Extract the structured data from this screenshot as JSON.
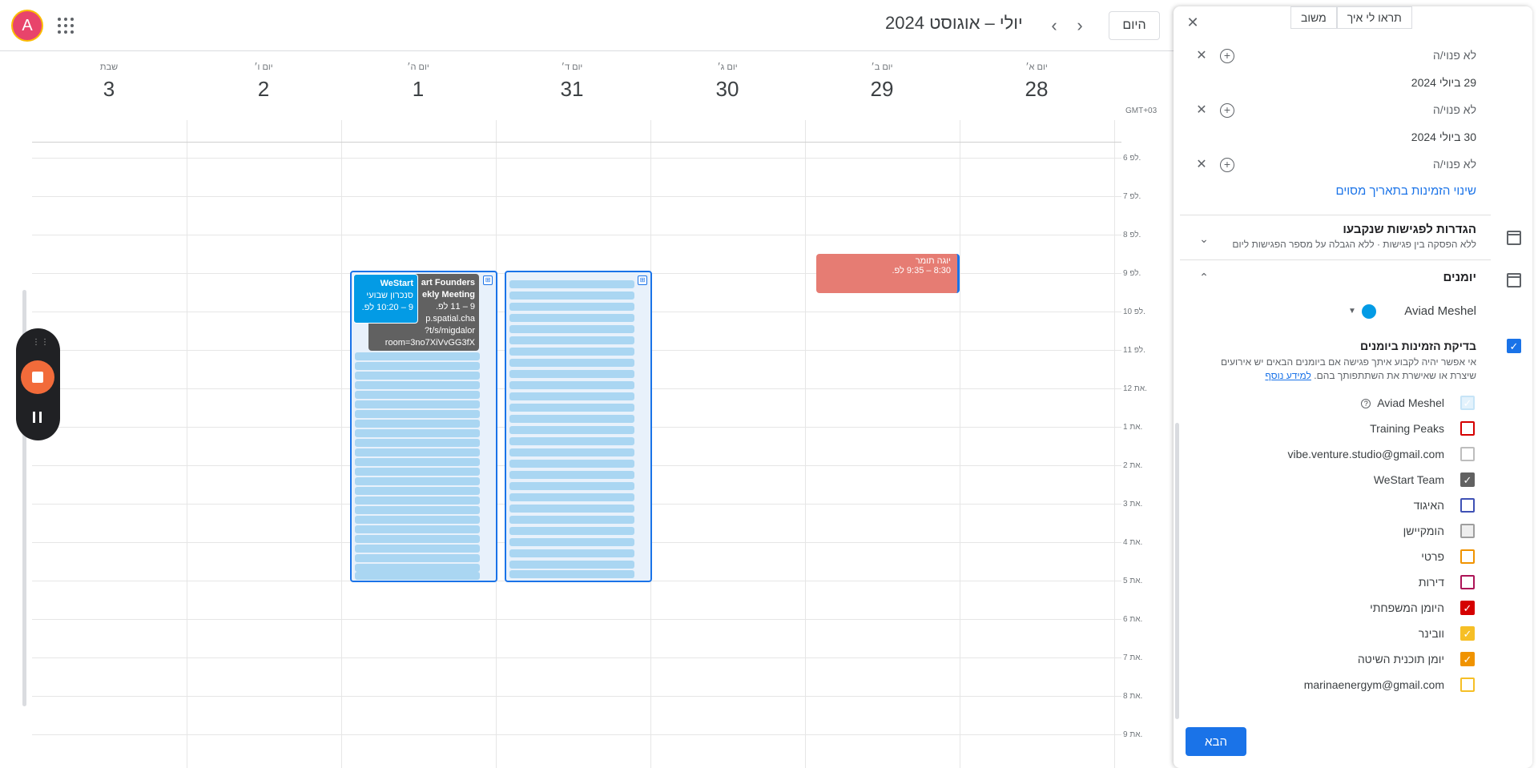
{
  "header": {
    "avatar_letter": "A",
    "today_label": "היום",
    "month_title": "יולי – אוגוסט 2024",
    "prev_glyph": "‹",
    "next_glyph": "›"
  },
  "timezone": "GMT+03",
  "days": [
    {
      "name": "יום א׳",
      "num": "28"
    },
    {
      "name": "יום ב׳",
      "num": "29"
    },
    {
      "name": "יום ג׳",
      "num": "30"
    },
    {
      "name": "יום ד׳",
      "num": "31"
    },
    {
      "name": "יום ה׳",
      "num": "1"
    },
    {
      "name": "יום ו׳",
      "num": "2"
    },
    {
      "name": "שבת",
      "num": "3"
    }
  ],
  "hours": [
    "6 לפ.",
    "7 לפ.",
    "8 לפ.",
    "9 לפ.",
    "10 לפ.",
    "11 לפ.",
    "12 את.",
    "1 את.",
    "2 את.",
    "3 את.",
    "4 את.",
    "5 את.",
    "6 את.",
    "7 את.",
    "8 את.",
    "9 את."
  ],
  "events": {
    "yoga": {
      "title": "יוגה תומר",
      "time": "8:30 – 9:35 לפ.",
      "color": "#e67c73"
    },
    "founders": {
      "title": "art Founders",
      "title2": "ekly Meeting",
      "time": "9 – 11 לפ.",
      "link1": "p.spatial.cha",
      "link2": "t/s/migdalor?",
      "link3": "room=3no7XiVvGG3fX",
      "color": "#616161"
    },
    "westart": {
      "title": "WeStart",
      "subtitle": "סנכרון שבועי",
      "time": "9 – 10:20 לפ.",
      "color": "#039be5"
    }
  },
  "recorder": {
    "dots": "⋮⋮"
  },
  "panel": {
    "close_glyph": "✕",
    "tabs": [
      "תראו לי איך",
      "משוב"
    ],
    "unavailable_label": "לא פנוי/ה",
    "dates": [
      "29 ביולי 2024",
      "30 ביולי 2024"
    ],
    "change_link": "שינוי הזמינות בתאריך מסוים",
    "booked_settings": {
      "title": "הגדרות לפגישות שנקבעו",
      "subtitle": "ללא הפסקה בין פגישות · ללא הגבלה על מספר הפגישות ליום"
    },
    "calendars_section": {
      "title": "יומנים",
      "owner": "Aviad Meshel",
      "check_label": "בדיקת הזמינות ביומנים",
      "check_desc": "אי אפשר יהיה לקבוע איתך פגישה אם ביומנים הבאים יש אירועים שיצרת או שאישרת את השתתפותך בהם.",
      "learn_more": "למידע נוסף"
    },
    "calendars": [
      {
        "name": "Aviad Meshel",
        "color": "#c6e4f7",
        "checked": true,
        "help": "?"
      },
      {
        "name": "Training Peaks",
        "color": "#d50000",
        "checked": false
      },
      {
        "name": "vibe.venture.studio@gmail.com",
        "color": "#bdbdbd",
        "checked": false
      },
      {
        "name": "WeStart Team",
        "color": "#616161",
        "checked": true
      },
      {
        "name": "האיגוד",
        "color": "#3f51b5",
        "checked": false
      },
      {
        "name": "הומקיישן",
        "color": "#9e9e9e",
        "checked": false
      },
      {
        "name": "פרטי",
        "color": "#f09300",
        "checked": false
      },
      {
        "name": "דירות",
        "color": "#ad1457",
        "checked": false
      },
      {
        "name": "היומן המשפחתי",
        "color": "#d50000",
        "checked": true
      },
      {
        "name": "וובינר",
        "color": "#f6bf26",
        "checked": true
      },
      {
        "name": "יומן תוכנית השיטה",
        "color": "#f09300",
        "checked": true
      },
      {
        "name": "marinaenergym@gmail.com",
        "color": "#f6bf26",
        "checked": false
      }
    ],
    "next_label": "הבא"
  }
}
